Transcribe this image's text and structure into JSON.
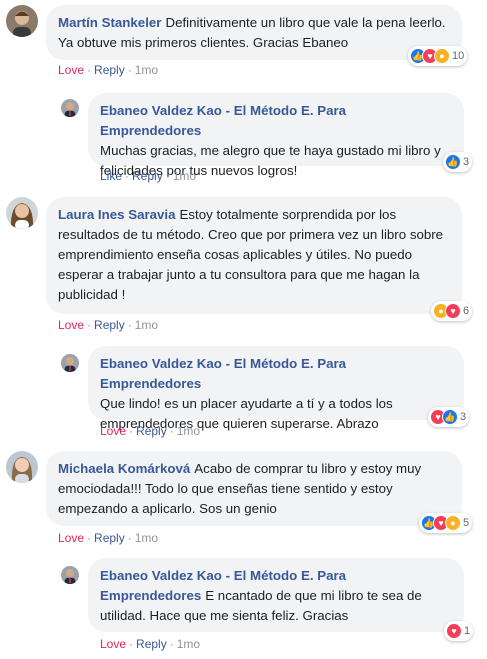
{
  "comments": [
    {
      "author": "Martín Stankeler",
      "text": "Definitivamente un libro que vale la pena leerlo. Ya obtuve mis primeros clientes. Gracias Ebaneo",
      "reactions": [
        "like",
        "love",
        "wow"
      ],
      "reaction_count": "10",
      "action1": "Love",
      "action2": "Reply",
      "time": "1mo"
    },
    {
      "author": "Ebaneo Valdez Kao - El Método E. Para Emprendedores",
      "text": "Muchas gracias, me alegro que te haya gustado mi libro y felicidades por tus nuevos logros!",
      "reactions": [
        "like"
      ],
      "reaction_count": "3",
      "action1": "Like",
      "action2": "Reply",
      "time": "1mo"
    },
    {
      "author": "Laura Ines Saravia",
      "text": "Estoy totalmente sorprendida por los resultados de tu método. Creo que por primera vez un libro sobre emprendimiento enseña cosas aplicables y útiles. No puedo esperar a trabajar junto a tu consultora para que me hagan la publicidad !",
      "reactions": [
        "wow",
        "love"
      ],
      "reaction_count": "6",
      "action1": "Love",
      "action2": "Reply",
      "time": "1mo"
    },
    {
      "author": "Ebaneo Valdez Kao - El Método E. Para Emprendedores",
      "text": "Que lindo! es un placer ayudarte a tí y a todos los emprendedores que quieren superarse. Abrazo",
      "reactions": [
        "love",
        "like"
      ],
      "reaction_count": "3",
      "action1": "Love",
      "action2": "Reply",
      "time": "1mo"
    },
    {
      "author": "Michaela Komárková",
      "text": "Acabo de comprar tu libro y estoy muy emociodada!!! Todo lo que enseñas tiene sentido y estoy empezando a aplicarlo. Sos un genio",
      "reactions": [
        "like",
        "love",
        "wow"
      ],
      "reaction_count": "5",
      "action1": "Love",
      "action2": "Reply",
      "time": "1mo"
    },
    {
      "author": "Ebaneo Valdez Kao - El Método E. Para Emprendedores",
      "text": "E ncantado de que mi libro te sea de utilidad. Hace que me sienta feliz. Gracias",
      "reactions": [
        "love"
      ],
      "reaction_count": "1",
      "action1": "Love",
      "action2": "Reply",
      "time": "1mo"
    }
  ],
  "colors": {
    "name": "#385898",
    "love_action": "#e0245e",
    "bubble": "#f2f3f5",
    "like": "#1877f2",
    "love": "#f33e58",
    "wow": "#f7b125"
  }
}
